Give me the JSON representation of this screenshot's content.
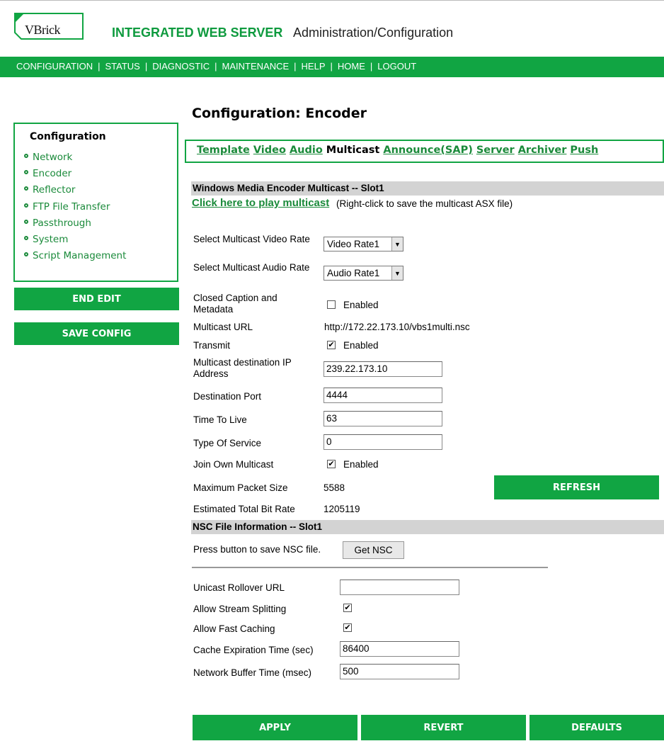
{
  "header": {
    "logo_text": "VBrick",
    "title": "INTEGRATED WEB SERVER",
    "subtitle": "Administration/Configuration"
  },
  "nav": [
    "CONFIGURATION",
    "STATUS",
    "DIAGNOSTIC",
    "MAINTENANCE",
    "HELP",
    "HOME",
    "LOGOUT"
  ],
  "sidebar": {
    "title": "Configuration",
    "items": [
      "Network",
      "Encoder",
      "Reflector",
      "FTP File Transfer",
      "Passthrough",
      "System",
      "Script Management"
    ],
    "end_edit": "END EDIT",
    "save_config": "SAVE CONFIG"
  },
  "main": {
    "title": "Configuration: Encoder",
    "tabs": [
      "Template",
      "Video",
      "Audio",
      "Multicast",
      "Announce(SAP)",
      "Server",
      "Archiver",
      "Push"
    ],
    "active_tab": "Multicast",
    "section1_title": "Windows Media Encoder Multicast -- Slot1",
    "play_link": "Click here to play multicast",
    "play_note": "(Right-click to save the multicast ASX file)",
    "video_rate_label": "Select Multicast Video Rate",
    "video_rate_value": "Video Rate1",
    "audio_rate_label": "Select Multicast Audio Rate",
    "audio_rate_value": "Audio Rate1",
    "cc_label": "Closed Caption and Metadata",
    "enabled_text": "Enabled",
    "multicast_url_label": "Multicast URL",
    "multicast_url_value": "http://172.22.173.10/vbs1multi.nsc",
    "transmit_label": "Transmit",
    "dest_ip_label": "Multicast destination IP Address",
    "dest_ip_value": "239.22.173.10",
    "dest_port_label": "Destination Port",
    "dest_port_value": "4444",
    "ttl_label": "Time To Live",
    "ttl_value": "63",
    "tos_label": "Type Of Service",
    "tos_value": "0",
    "join_label": "Join Own Multicast",
    "max_packet_label": "Maximum Packet Size",
    "max_packet_value": "5588",
    "refresh": "REFRESH",
    "bitrate_label": "Estimated Total Bit Rate",
    "bitrate_value": "1205119",
    "section2_title": "NSC File Information -- Slot1",
    "nsc_press": "Press button to save NSC file.",
    "get_nsc": "Get NSC",
    "unicast_label": "Unicast Rollover URL",
    "unicast_value": "",
    "splitting_label": "Allow Stream Splitting",
    "fastcache_label": "Allow Fast Caching",
    "cache_exp_label": "Cache Expiration Time (sec)",
    "cache_exp_value": "86400",
    "net_buffer_label": "Network Buffer Time (msec)",
    "net_buffer_value": "500",
    "apply": "APPLY",
    "revert": "REVERT",
    "defaults": "DEFAULTS"
  },
  "state": {
    "cc_checked": false,
    "transmit_checked": true,
    "join_checked": true,
    "splitting_checked": true,
    "fastcache_checked": true
  },
  "colors": {
    "accent": "#11a543",
    "link": "#1a8a3a",
    "section_bar": "#d3d3d3"
  },
  "icons": {
    "checkbox_checked": "check-icon",
    "dropdown": "chevron-down-icon"
  }
}
